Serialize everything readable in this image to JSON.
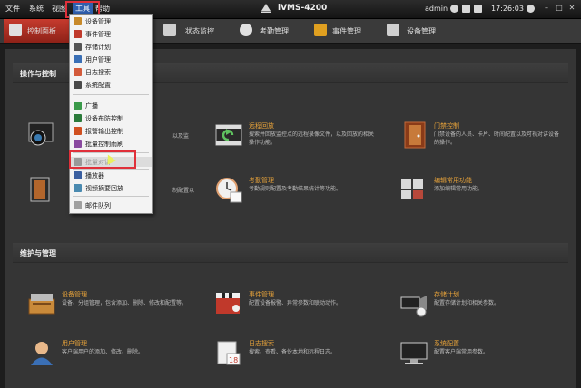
{
  "menubar": {
    "items": [
      {
        "label": "文件",
        "active": false
      },
      {
        "label": "系统",
        "active": false
      },
      {
        "label": "视图",
        "active": false
      },
      {
        "label": "工具",
        "active": true
      },
      {
        "label": "帮助",
        "active": false
      }
    ]
  },
  "app": {
    "title": "iVMS-4200"
  },
  "status": {
    "user": "admin",
    "time": "17:26:03"
  },
  "tabs": [
    {
      "label": "控制面板",
      "active": true
    },
    {
      "label": "状态监控",
      "active": false
    },
    {
      "label": "考勤管理",
      "active": false
    },
    {
      "label": "事件管理",
      "active": false
    },
    {
      "label": "设备管理",
      "active": false
    }
  ],
  "sections": {
    "ops": {
      "title": "操作与控制"
    },
    "maint": {
      "title": "维护与管理"
    }
  },
  "features": {
    "preview": {
      "title": "",
      "desc": "以及监"
    },
    "playback": {
      "title": "远程回放",
      "desc": "搜索并回放监控点的远程录像文件，以及回放的相关操作功能。"
    },
    "door": {
      "title": "门禁控制",
      "desc": "门禁设备的人员、卡片、时间配置以及可视对讲设备的操作。"
    },
    "card": {
      "title": "",
      "desc": "制配置以"
    },
    "attendance": {
      "title": "考勤管理",
      "desc": "考勤规则配置及考勤结果统计等功能。"
    },
    "common": {
      "title": "编辑常用功能",
      "desc": "添加编辑常用功能。"
    },
    "device": {
      "title": "设备管理",
      "desc": "设备、分组管理，包含添加、删除、修改和配置等。"
    },
    "event": {
      "title": "事件管理",
      "desc": "配置设备报警、异常参数和联动动作。"
    },
    "storage": {
      "title": "存储计划",
      "desc": "配置存储计划和相关参数。"
    },
    "user": {
      "title": "用户管理",
      "desc": "客户端用户的添加、修改、删除。"
    },
    "log": {
      "title": "日志搜索",
      "desc": "搜索、查看、备份本地和远程日志。"
    },
    "sysconfig": {
      "title": "系统配置",
      "desc": "配置客户端常用参数。"
    }
  },
  "dropdown": {
    "items": [
      {
        "label": "设备管理",
        "color": "#c88a2a"
      },
      {
        "label": "事件管理",
        "color": "#c0392b"
      },
      {
        "label": "存储计划",
        "color": "#555555"
      },
      {
        "label": "用户管理",
        "color": "#3a6fb5"
      },
      {
        "label": "日志搜索",
        "color": "#d35a3a"
      },
      {
        "label": "系统配置",
        "color": "#4a4a4a"
      },
      {
        "label": "广播",
        "color": "#3a9a4a"
      },
      {
        "label": "设备布防控制",
        "color": "#2a7a3a"
      },
      {
        "label": "报警输出控制",
        "color": "#d05020"
      },
      {
        "label": "批量控制雨刷",
        "color": "#8a4aa0"
      },
      {
        "label": "批量对讲",
        "color": "#999999"
      },
      {
        "label": "播放器",
        "color": "#3a5fa0"
      },
      {
        "label": "视频摘要回放",
        "color": "#4a8ab0"
      },
      {
        "label": "邮件队列",
        "color": "#a0a0a0"
      }
    ]
  }
}
